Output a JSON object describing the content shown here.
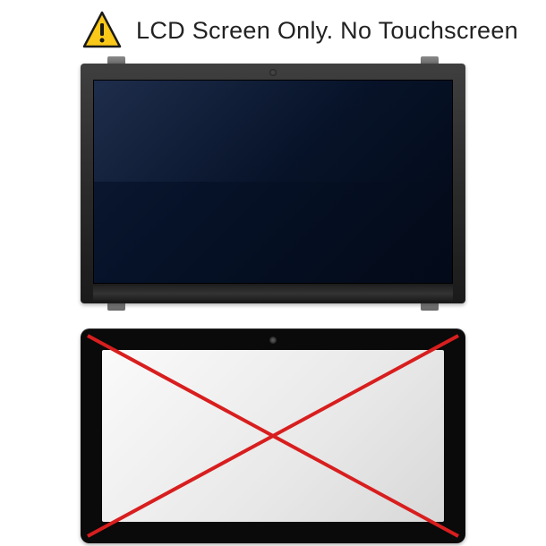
{
  "header": {
    "text": "LCD Screen Only. No Touchscreen"
  },
  "icons": {
    "warning": "warning-triangle-icon"
  },
  "colors": {
    "warning_yellow": "#f9c818",
    "cross_red": "#d81e1e",
    "screen_navy": "#0d1a35"
  }
}
